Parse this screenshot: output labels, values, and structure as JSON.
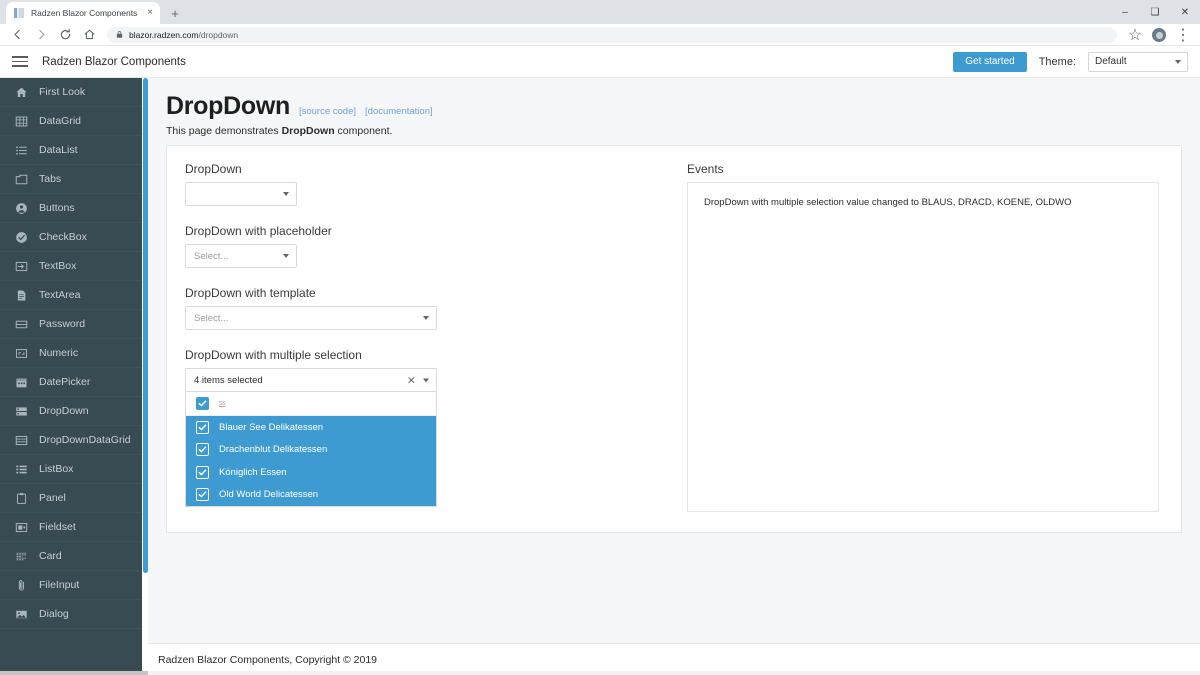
{
  "browser": {
    "tab_title": "Radzen Blazor Components",
    "tab_close": "×",
    "new_tab": "+",
    "window_minimize": "–",
    "window_maximize": "❑",
    "window_close": "✕",
    "url_domain": "blazor.radzen.com",
    "url_path": "/dropdown",
    "star_icon": "☆",
    "menu_icon": "⋮"
  },
  "appbar": {
    "title": "Radzen Blazor Components",
    "get_started": "Get started",
    "theme_label": "Theme:",
    "theme_value": "Default"
  },
  "sidebar": {
    "items": [
      {
        "label": "First Look",
        "icon": "home-icon"
      },
      {
        "label": "DataGrid",
        "icon": "grid-icon"
      },
      {
        "label": "DataList",
        "icon": "list-icon"
      },
      {
        "label": "Tabs",
        "icon": "tabs-icon"
      },
      {
        "label": "Buttons",
        "icon": "user-circle-icon"
      },
      {
        "label": "CheckBox",
        "icon": "check-circle-icon"
      },
      {
        "label": "TextBox",
        "icon": "input-icon"
      },
      {
        "label": "TextArea",
        "icon": "document-icon"
      },
      {
        "label": "Password",
        "icon": "password-icon"
      },
      {
        "label": "Numeric",
        "icon": "numeric-icon"
      },
      {
        "label": "DatePicker",
        "icon": "calendar-icon"
      },
      {
        "label": "DropDown",
        "icon": "dropdown-icon"
      },
      {
        "label": "DropDownDataGrid",
        "icon": "datagrid-icon"
      },
      {
        "label": "ListBox",
        "icon": "listbox-icon"
      },
      {
        "label": "Panel",
        "icon": "panel-icon"
      },
      {
        "label": "Fieldset",
        "icon": "fieldset-icon"
      },
      {
        "label": "Card",
        "icon": "card-icon"
      },
      {
        "label": "FileInput",
        "icon": "paperclip-icon"
      },
      {
        "label": "Dialog",
        "icon": "image-icon"
      }
    ]
  },
  "page": {
    "title": "DropDown",
    "source_code_link": "[source code]",
    "documentation_link": "[documentation]",
    "subtitle_before": "This page demonstrates ",
    "subtitle_bold": "DropDown",
    "subtitle_after": " component."
  },
  "demo": {
    "section_title": "DropDown",
    "fields": [
      {
        "label": "DropDown",
        "value": "",
        "placeholder": ""
      },
      {
        "label": "DropDown with placeholder",
        "value": "",
        "placeholder": "Select..."
      },
      {
        "label": "DropDown with template",
        "value": "",
        "placeholder": "Select..."
      }
    ],
    "multi": {
      "label": "DropDown with multiple selection",
      "value": "4 items selected",
      "clear_label": "×",
      "filter_text": "ss",
      "options": [
        {
          "label": "Blauer See Delikatessen",
          "selected": true
        },
        {
          "label": "Drachenblut Delikatessen",
          "selected": true
        },
        {
          "label": "Königlich Essen",
          "selected": true
        },
        {
          "label": "Old World Delicatessen",
          "selected": true
        }
      ]
    }
  },
  "events": {
    "title": "Events",
    "entries": [
      "DropDown with multiple selection value changed to BLAUS, DRACD, KOENE, OLDWO"
    ]
  },
  "footer": {
    "text": "Radzen Blazor Components, Copyright © 2019"
  },
  "colors": {
    "accent": "#3d9bd1",
    "sidebar_bg": "#384a52",
    "page_bg": "#f5f6f7"
  }
}
